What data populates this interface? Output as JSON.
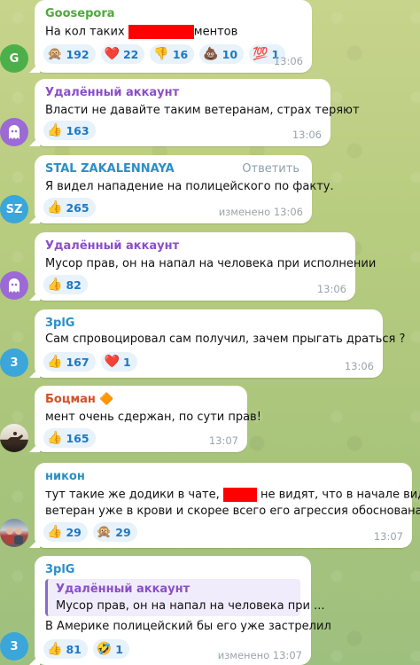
{
  "messages": [
    {
      "author": "Goosepora",
      "author_color": "#4fa83d",
      "text_before": "На кол таких ",
      "text_after": "ментов",
      "time": "13:06",
      "avatar_letter": "G",
      "avatar_color": "#4cb04a",
      "reactions": [
        {
          "icon": "monkey-icon",
          "emoji": "🙊",
          "count": "192"
        },
        {
          "icon": "heart-icon",
          "emoji": "❤️",
          "count": "22"
        },
        {
          "icon": "thumbs-down-icon",
          "emoji": "👎",
          "count": "16"
        },
        {
          "icon": "poop-icon",
          "emoji": "💩",
          "count": "10"
        },
        {
          "icon": "hundred-icon",
          "emoji": "💯",
          "count": "1"
        }
      ]
    },
    {
      "author": "Удалённый аккаунт",
      "author_color": "#8b4fc7",
      "text": "Власти не давайте таким ветеранам, страх теряют",
      "time": "13:06",
      "avatar_color": "#9b6ad6",
      "reactions": [
        {
          "icon": "thumbs-up-icon",
          "emoji": "👍",
          "count": "163"
        }
      ]
    },
    {
      "author": "STAL ZAKALENNAYA",
      "author_color": "#2a8fc6",
      "reply_label": "Ответить",
      "text": "Я видел нападение на полицейского по факту.",
      "time": "изменено 13:06",
      "avatar_letter": "SZ",
      "avatar_color": "#3aa6d9",
      "reactions": [
        {
          "icon": "thumbs-up-icon",
          "emoji": "👍",
          "count": "265"
        }
      ]
    },
    {
      "author": "Удалённый аккаунт",
      "author_color": "#8b4fc7",
      "text": "Мусор прав, он на напал на человека при исполнении",
      "time": "13:06",
      "avatar_color": "#9b6ad6",
      "reactions": [
        {
          "icon": "thumbs-up-icon",
          "emoji": "👍",
          "count": "82"
        }
      ]
    },
    {
      "author": "3plG",
      "author_color": "#2a8fc6",
      "text": "Сам спровоцировал сам получил, зачем прыгать драться ?",
      "time": "13:06",
      "avatar_letter": "3",
      "avatar_color": "#3aa6d9",
      "reactions": [
        {
          "icon": "thumbs-up-icon",
          "emoji": "👍",
          "count": "167"
        },
        {
          "icon": "heart-icon",
          "emoji": "❤️",
          "count": "1"
        }
      ]
    },
    {
      "author": "Боцман",
      "author_badge": "🔶",
      "author_color": "#d4502c",
      "text": "мент очень сдержан, по сути прав!",
      "time": "13:07",
      "reactions": [
        {
          "icon": "thumbs-up-icon",
          "emoji": "👍",
          "count": "165"
        }
      ]
    },
    {
      "author": "никон",
      "author_color": "#2a8fc6",
      "text_line1_before": "тут такие же додики в чате, ",
      "text_line1_after": " не видят, что в начале видео",
      "text_line2": "ветеран уже в крови и скорее всего его агрессия обоснована.",
      "time": "13:07",
      "reactions": [
        {
          "icon": "thumbs-up-icon",
          "emoji": "👍",
          "count": "29"
        },
        {
          "icon": "monkey-icon",
          "emoji": "🙊",
          "count": "29"
        }
      ]
    },
    {
      "author": "3plG",
      "author_color": "#2a8fc6",
      "quote_author": "Удалённый аккаунт",
      "quote_text": "Мусор прав, он на напал на человека при ...",
      "text": "В Америке полицейский бы его уже застрелил",
      "time": "изменено 13:07",
      "avatar_letter": "3",
      "avatar_color": "#3aa6d9",
      "reactions": [
        {
          "icon": "thumbs-up-icon",
          "emoji": "👍",
          "count": "81"
        },
        {
          "icon": "rofl-icon",
          "emoji": "🤣",
          "count": "1"
        }
      ]
    }
  ]
}
